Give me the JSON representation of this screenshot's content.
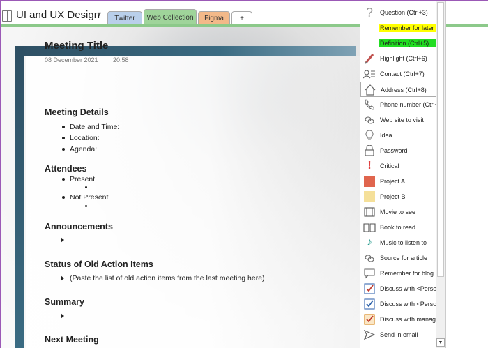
{
  "header": {
    "notebook_title": "UI and UX Design",
    "tabs": [
      {
        "label": "Twitter",
        "color": "#b9cfea"
      },
      {
        "label": "Web Collection",
        "color": "#9fd49a"
      },
      {
        "label": "Figma",
        "color": "#f3b989"
      },
      {
        "label": "+",
        "color": "#ffffff"
      }
    ]
  },
  "note": {
    "title": "Meeting Title",
    "date": "08 December 2021",
    "time": "20:58",
    "sections": {
      "details_heading": "Meeting Details",
      "details_items": [
        "Date and Time:",
        "Location:",
        "Agenda:"
      ],
      "attendees_heading": "Attendees",
      "attendees_items": [
        "Present",
        "Not Present"
      ],
      "announcements_heading": "Announcements",
      "status_heading": "Status of Old Action Items",
      "status_item": "(Paste the list of old action items from the last meeting here)",
      "summary_heading": "Summary",
      "next_heading": "Next Meeting"
    }
  },
  "tag_menu": {
    "items": [
      {
        "label": "Question (Ctrl+3)",
        "icon": "question-icon"
      },
      {
        "label": "Remember for later",
        "icon": "",
        "highlight": "#ffff00"
      },
      {
        "label": "Definition (Ctrl+5)",
        "icon": "",
        "highlight": "#22dd22"
      },
      {
        "label": "Highlight (Ctrl+6)",
        "icon": "highlighter-pen-icon"
      },
      {
        "label": "Contact (Ctrl+7)",
        "icon": "contact-card-icon"
      },
      {
        "label": "Address (Ctrl+8)",
        "icon": "house-icon"
      },
      {
        "label": "Phone number (Ctrl+",
        "icon": "phone-icon"
      },
      {
        "label": "Web site to visit",
        "icon": "web-link-icon"
      },
      {
        "label": "Idea",
        "icon": "lightbulb-icon"
      },
      {
        "label": "Password",
        "icon": "padlock-icon"
      },
      {
        "label": "Critical",
        "icon": "exclamation-icon"
      },
      {
        "label": "Project A",
        "icon": "project-a-square-icon",
        "color": "#e0654e"
      },
      {
        "label": "Project B",
        "icon": "project-b-square-icon",
        "color": "#f5e09a"
      },
      {
        "label": "Movie to see",
        "icon": "film-strip-icon"
      },
      {
        "label": "Book to read",
        "icon": "book-icon"
      },
      {
        "label": "Music to listen to",
        "icon": "music-note-icon"
      },
      {
        "label": "Source for article",
        "icon": "source-link-icon"
      },
      {
        "label": "Remember for blog",
        "icon": "speech-bubble-icon"
      },
      {
        "label": "Discuss with <Person A>",
        "icon": "checkbox-person-icon"
      },
      {
        "label": "Discuss with <Person B>",
        "icon": "checkbox-person-icon"
      },
      {
        "label": "Discuss with manager",
        "icon": "checkbox-manager-icon"
      },
      {
        "label": "Send in email",
        "icon": "send-arrow-icon"
      }
    ]
  }
}
